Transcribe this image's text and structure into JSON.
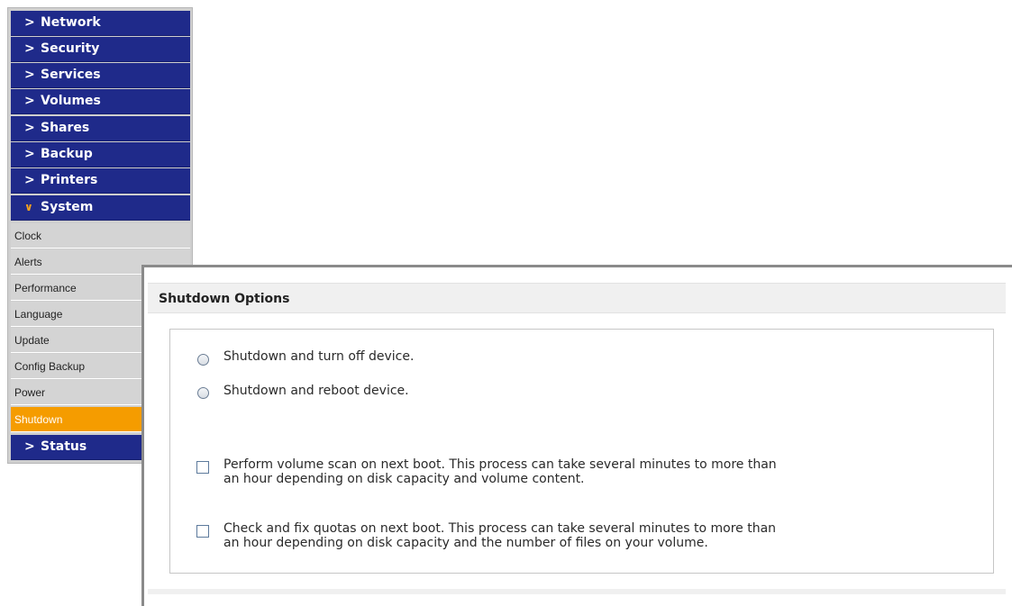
{
  "sidebar": {
    "main_items": [
      {
        "label": "Network",
        "icon": "chevron-right-icon",
        "expanded": false
      },
      {
        "label": "Security",
        "icon": "chevron-right-icon",
        "expanded": false
      },
      {
        "label": "Services",
        "icon": "chevron-right-icon",
        "expanded": false
      },
      {
        "label": "Volumes",
        "icon": "chevron-right-icon",
        "expanded": false
      },
      {
        "label": "Shares",
        "icon": "chevron-right-icon",
        "expanded": false
      },
      {
        "label": "Backup",
        "icon": "chevron-right-icon",
        "expanded": false
      },
      {
        "label": "Printers",
        "icon": "chevron-right-icon",
        "expanded": false
      },
      {
        "label": "System",
        "icon": "chevron-down-icon",
        "expanded": true
      }
    ],
    "system_subitems": [
      {
        "label": "Clock",
        "active": false
      },
      {
        "label": "Alerts",
        "active": false
      },
      {
        "label": "Performance",
        "active": false
      },
      {
        "label": "Language",
        "active": false
      },
      {
        "label": "Update",
        "active": false
      },
      {
        "label": "Config Backup",
        "active": false
      },
      {
        "label": "Power",
        "active": false
      },
      {
        "label": "Shutdown",
        "active": true
      }
    ],
    "status_item": {
      "label": "Status",
      "icon": "chevron-right-icon"
    }
  },
  "panel": {
    "title": "Shutdown Options",
    "radio_options": [
      {
        "label": "Shutdown and turn off device.",
        "checked": false
      },
      {
        "label": "Shutdown and reboot device.",
        "checked": false
      }
    ],
    "checkbox_options": [
      {
        "line1": "Perform volume scan on next boot. This process can take several minutes to more than",
        "line2": "an hour depending on disk capacity and volume content.",
        "checked": false
      },
      {
        "line1": "Check and fix quotas on next boot. This process can take several minutes to more than",
        "line2": "an hour depending on disk capacity and the number of files on your volume.",
        "checked": false
      }
    ]
  },
  "colors": {
    "nav_blue": "#1f2a8a",
    "active_orange": "#f59c00",
    "submenu_gray": "#d4d4d4"
  }
}
